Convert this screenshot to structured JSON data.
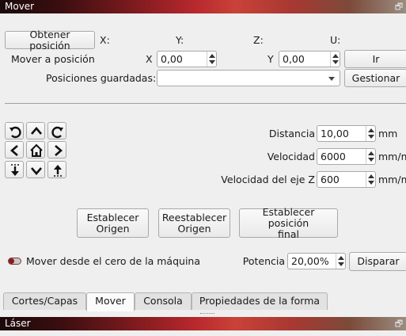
{
  "panels": {
    "top_title": "Mover",
    "bottom_title": "Láser",
    "close_glyph": "🗗"
  },
  "position": {
    "get_button": "Obtener posición",
    "x_label": "X:",
    "y_label": "Y:",
    "z_label": "Z:",
    "u_label": "U:",
    "move_label": "Mover a posición",
    "x_field_label": "X",
    "x_value": "0,00",
    "y_field_label": "Y",
    "y_value": "0,00",
    "go_button": "Ir",
    "saved_label": "Posiciones guardadas:",
    "saved_value": "",
    "manage_button": "Gestionar"
  },
  "jog": {
    "distance_label": "Distancia",
    "distance_value": "10,00",
    "distance_unit": "mm",
    "speed_label": "Velocidad",
    "speed_value": "6000",
    "speed_unit": "mm/m",
    "zspeed_label": "Velocidad del eje Z",
    "zspeed_value": "600",
    "zspeed_unit": "mm/m"
  },
  "actions": {
    "set_origin_l1": "Establecer",
    "set_origin_l2": "Origen",
    "reset_origin_l1": "Reestablecer",
    "reset_origin_l2": "Origen",
    "set_final_l1": "Establecer posición",
    "set_final_l2": "final"
  },
  "laser": {
    "machine_zero_label": "Mover desde el cero de la máquina",
    "machine_zero_on": false,
    "power_label": "Potencia",
    "power_value": "20,00%",
    "fire_button": "Disparar"
  },
  "tabs": [
    {
      "label": "Cortes/Capas",
      "active": false
    },
    {
      "label": "Mover",
      "active": true
    },
    {
      "label": "Consola",
      "active": false
    },
    {
      "label": "Propiedades de la forma",
      "active": false
    }
  ],
  "colors": {
    "accent": "#8b1b1b",
    "background": "#efefef"
  }
}
